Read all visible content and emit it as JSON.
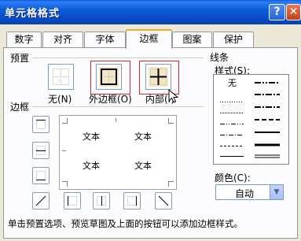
{
  "window": {
    "title": "单元格格式",
    "help_label": "?",
    "close_label": "✕"
  },
  "tabs": [
    {
      "label": "数字"
    },
    {
      "label": "对齐"
    },
    {
      "label": "字体"
    },
    {
      "label": "边框",
      "active": true
    },
    {
      "label": "图案"
    },
    {
      "label": "保护"
    }
  ],
  "presets": {
    "section_label": "预置",
    "items": [
      {
        "label": "无(N)",
        "icon": "no-border-icon"
      },
      {
        "label": "外边框(O)",
        "icon": "outline-border-icon"
      },
      {
        "label": "内部(I)",
        "icon": "inside-border-icon"
      }
    ]
  },
  "border": {
    "section_label": "边框",
    "preview_texts": [
      "文本",
      "文本",
      "文本",
      "文本"
    ]
  },
  "line": {
    "section_label": "线条",
    "style_label": "样式(S):",
    "none_label": "无",
    "color_label": "颜色(C):",
    "color_value": "自动"
  },
  "footer": {
    "hint": "单击预置选项、预览草图及上面的按钮可以添加边框样式。"
  },
  "colors": {
    "accent_tab": "#f5a623",
    "title_bar": "#0a5fe0",
    "highlight": "#d02828"
  }
}
